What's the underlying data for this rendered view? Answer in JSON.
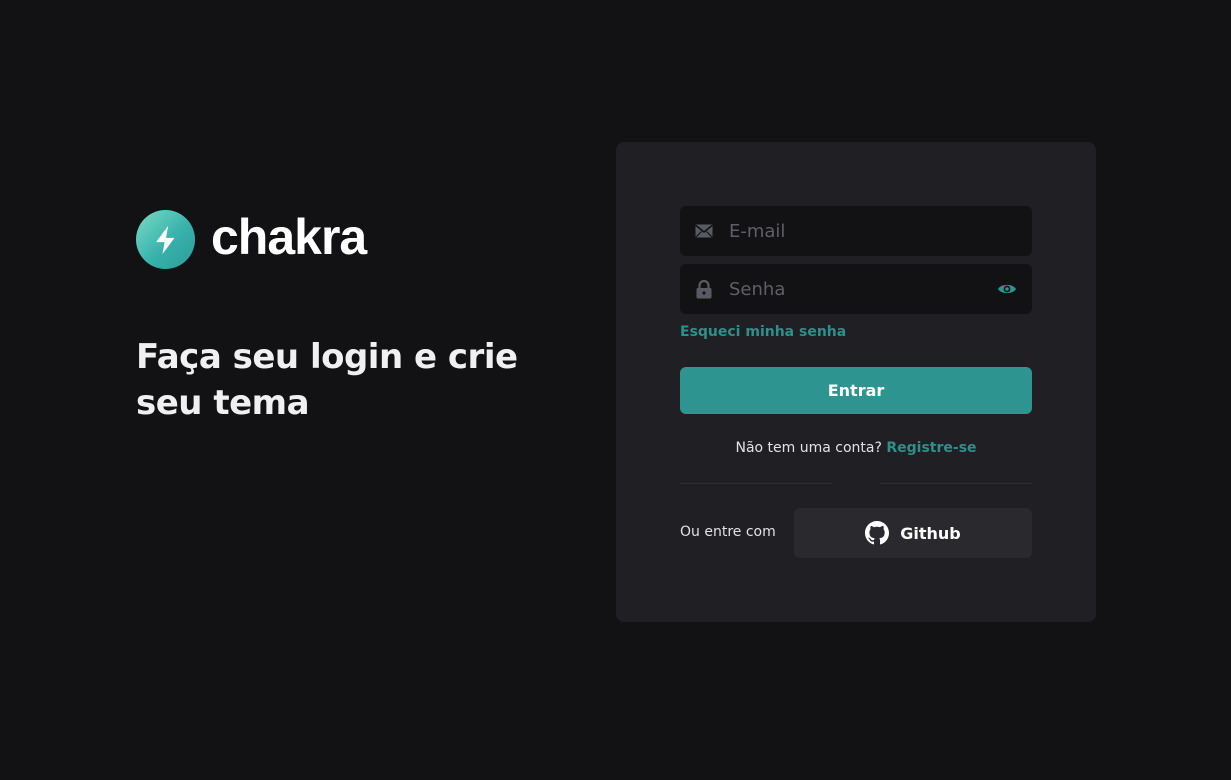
{
  "brand": {
    "wordmark": "chakra",
    "icon": "lightning-bolt-icon",
    "colors": {
      "gradient_start": "#7bdcc5",
      "gradient_end": "#2c9d99"
    }
  },
  "hero": {
    "title": "Faça seu login e crie seu tema"
  },
  "login_form": {
    "email": {
      "placeholder": "E-mail",
      "value": "",
      "icon": "envelope-icon"
    },
    "password": {
      "placeholder": "Senha",
      "value": "",
      "icon": "lock-icon",
      "toggle_icon": "eye-icon"
    },
    "forgot_password": "Esqueci minha senha",
    "submit_label": "Entrar",
    "signup_prompt": "Não tem uma conta?",
    "signup_link": "Registre-se",
    "alt_login_label": "Ou entre com",
    "github_label": "Github",
    "github_icon": "github-icon"
  },
  "colors": {
    "background": "#121214",
    "card": "#202024",
    "input": "#121214",
    "accent": "#2e948f",
    "link": "#2e8f8b",
    "secondary_button": "#29292e"
  }
}
